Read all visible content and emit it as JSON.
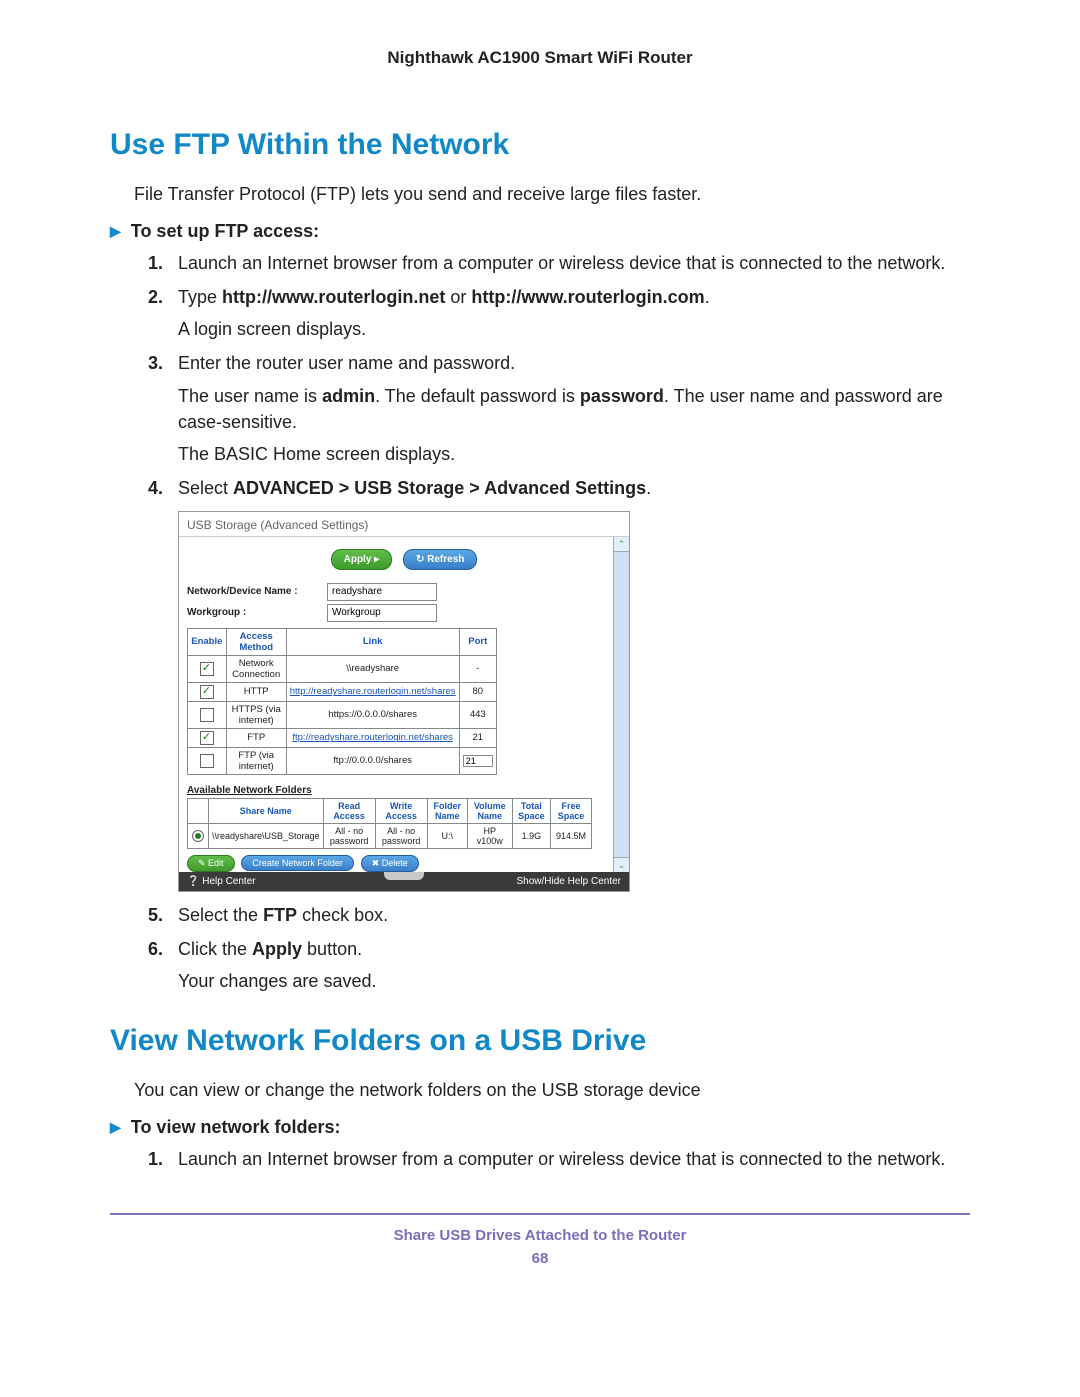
{
  "header": {
    "title": "Nighthawk AC1900 Smart WiFi Router"
  },
  "section1": {
    "title": "Use FTP Within the Network",
    "intro": "File Transfer Protocol (FTP) lets you send and receive large files faster.",
    "procHeading": "To set up FTP access:",
    "steps": {
      "s1": "Launch an Internet browser from a computer or wireless device that is connected to the network.",
      "s2a": "Type ",
      "s2b": "http://www.routerlogin.net",
      "s2c": " or ",
      "s2d": "http://www.routerlogin.com",
      "s2e": ".",
      "s2p": "A login screen displays.",
      "s3": "Enter the router user name and password.",
      "s3p1a": "The user name is ",
      "s3p1b": "admin",
      "s3p1c": ". The default password is ",
      "s3p1d": "password",
      "s3p1e": ". The user name and password are case-sensitive.",
      "s3p2": "The BASIC Home screen displays.",
      "s4a": "Select ",
      "s4b": "ADVANCED > USB Storage > Advanced Settings",
      "s4c": ".",
      "s5a": "Select the ",
      "s5b": "FTP",
      "s5c": " check box.",
      "s6a": "Click the ",
      "s6b": "Apply",
      "s6c": " button.",
      "s6p": "Your changes are saved."
    }
  },
  "screenshot": {
    "title": "USB Storage (Advanced Settings)",
    "buttons": {
      "apply": "Apply ▸",
      "refresh": "↻ Refresh"
    },
    "form": {
      "deviceLabel": "Network/Device Name :",
      "deviceValue": "readyshare",
      "workgroupLabel": "Workgroup :",
      "workgroupValue": "Workgroup"
    },
    "accessHeaders": {
      "enable": "Enable",
      "method": "Access Method",
      "link": "Link",
      "port": "Port"
    },
    "accessRows": [
      {
        "enabled": true,
        "method": "Network Connection",
        "link": "\\\\readyshare",
        "isLink": false,
        "port": "-",
        "editable": false
      },
      {
        "enabled": true,
        "method": "HTTP",
        "link": "http://readyshare.routerlogin.net/shares",
        "isLink": true,
        "port": "80",
        "editable": false
      },
      {
        "enabled": false,
        "method": "HTTPS (via internet)",
        "link": "https://0.0.0.0/shares",
        "isLink": false,
        "port": "443",
        "editable": false
      },
      {
        "enabled": true,
        "method": "FTP",
        "link": "ftp://readyshare.routerlogin.net/shares",
        "isLink": true,
        "port": "21",
        "editable": false
      },
      {
        "enabled": false,
        "method": "FTP (via internet)",
        "link": "ftp://0.0.0.0/shares",
        "isLink": false,
        "port": "21",
        "editable": true
      }
    ],
    "foldersHeading": "Available Network Folders",
    "folderHeaders": {
      "sel": "",
      "share": "Share Name",
      "read": "Read Access",
      "write": "Write Access",
      "folder": "Folder Name",
      "vol": "Volume Name",
      "total": "Total Space",
      "free": "Free Space"
    },
    "folderRow": {
      "share": "\\\\readyshare\\USB_Storage",
      "read": "All - no password",
      "write": "All - no password",
      "folder": "U:\\",
      "vol": "HP v100w",
      "total": "1.9G",
      "free": "914.5M"
    },
    "actionButtons": {
      "edit": "✎ Edit",
      "create": "Create Network Folder",
      "delete": "✖ Delete"
    },
    "footerLeft": "❔ Help Center",
    "footerRight": "Show/Hide Help Center"
  },
  "section2": {
    "title": "View Network Folders on a USB Drive",
    "intro": "You can view or change the network folders on the USB storage device",
    "procHeading": "To view network folders:",
    "s1": "Launch an Internet browser from a computer or wireless device that is connected to the network."
  },
  "footer": {
    "text": "Share USB Drives Attached to the Router",
    "page": "68"
  }
}
